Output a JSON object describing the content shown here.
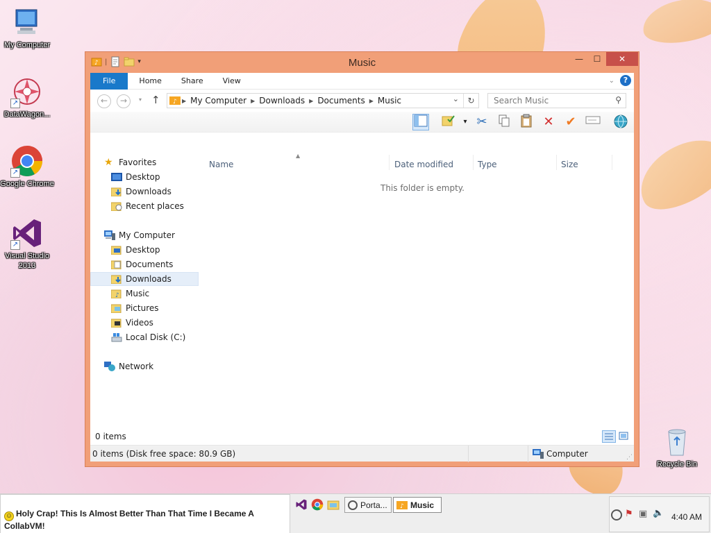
{
  "desktop": {
    "icons": [
      {
        "label": "My Computer"
      },
      {
        "label": "DataWagon..."
      },
      {
        "label": "Google Chrome"
      },
      {
        "label": "Visual Studio 2013"
      },
      {
        "label": "Recycle Bin"
      }
    ]
  },
  "window": {
    "title": "Music",
    "minimize_glyph": "—",
    "maximize_glyph": "☐",
    "close_glyph": "✕",
    "ribbon": {
      "tabs": [
        "File",
        "Home",
        "Share",
        "View"
      ],
      "help_glyph": "?"
    },
    "address": {
      "crumbs": [
        "My Computer",
        "Downloads",
        "Documents",
        "Music"
      ],
      "search_placeholder": "Search Music"
    },
    "nav": {
      "favorites_label": "Favorites",
      "favorites": [
        "Desktop",
        "Downloads",
        "Recent places"
      ],
      "computer_label": "My Computer",
      "computer_items": [
        "Desktop",
        "Documents",
        "Downloads",
        "Music",
        "Pictures",
        "Videos",
        "Local Disk (C:)"
      ],
      "selected": "Downloads",
      "network_label": "Network"
    },
    "columns": [
      "Name",
      "Date modified",
      "Type",
      "Size"
    ],
    "empty_text": "This folder is empty.",
    "item_count": "0 items",
    "status_left": "0 items (Disk free space: 80.9 GB)",
    "status_right": "Computer"
  },
  "taskbar": {
    "ticker": "Holy Crap! This Is Almost Better Than That Time I Became A CollabVM!",
    "buttons": [
      {
        "label": "Porta..."
      },
      {
        "label": "Music"
      }
    ],
    "clock": "4:40 AM"
  },
  "colors": {
    "frame": "#f19f78",
    "file_tab": "#1979ca",
    "close": "#c7504a"
  }
}
